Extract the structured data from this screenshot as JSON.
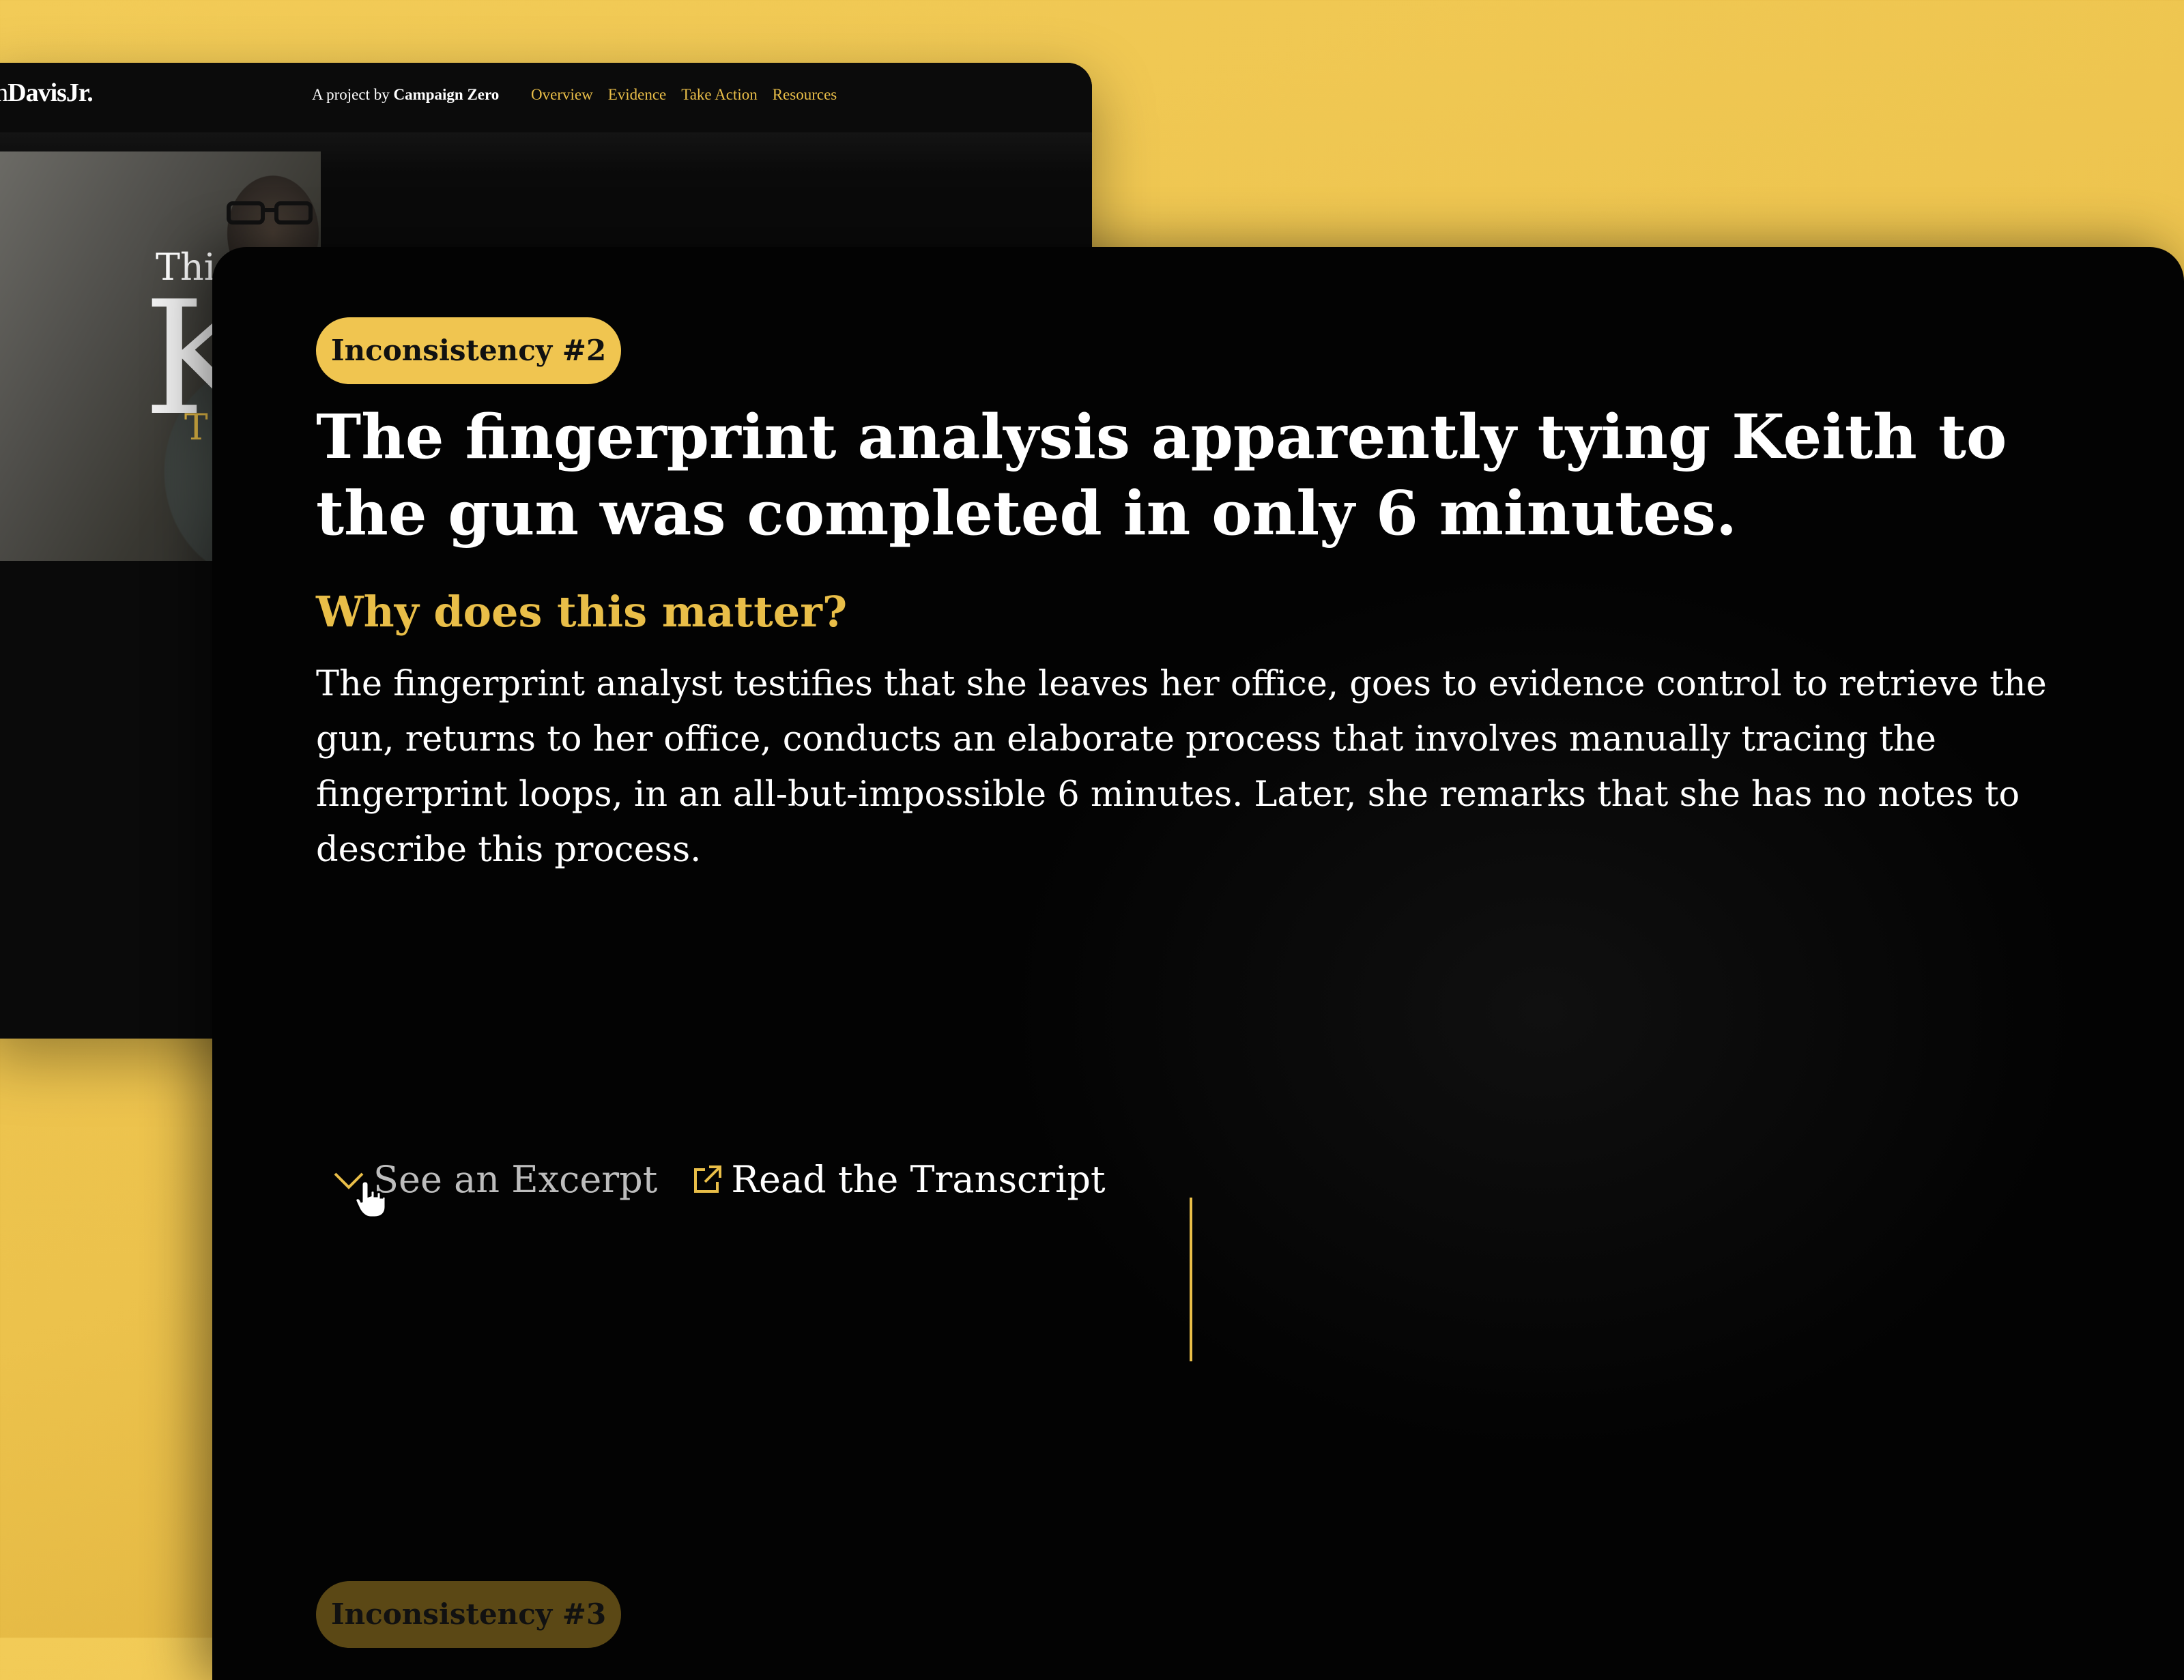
{
  "back_window": {
    "brand_part1": "ith",
    "brand_part2": "DavisJr.",
    "project_prefix": "A project by ",
    "project_org": "Campaign Zero",
    "nav": [
      "Overview",
      "Evidence",
      "Take Action",
      "Resources"
    ],
    "hero_small": "Thi",
    "hero_big": "K",
    "hero_sub": "T"
  },
  "main": {
    "badge": "Inconsistency #2",
    "headline": "The fingerprint analysis apparently tying Keith to the gun was completed in only 6 minutes.",
    "why_heading": "Why does this matter?",
    "body": "The fingerprint analyst testifies that she leaves her office, goes to evidence control to retrieve the gun, returns to her office, conducts an elaborate process that involves manually tracing the fingerprint loops, in an all-but-impossible 6 minutes. Later, she remarks that she has no notes to describe this process.",
    "excerpt_label": "See an Excerpt",
    "transcript_label": "Read the Transcript",
    "next_badge": "Inconsistency #3"
  },
  "icons": {
    "excerpt": "chevron-down-icon",
    "transcript": "external-link-icon",
    "cursor": "hand-cursor-icon"
  },
  "colors": {
    "accent": "#e9be48",
    "badge_bg": "#f0c550",
    "background": "#f2cb57",
    "window_bg": "#030303"
  }
}
